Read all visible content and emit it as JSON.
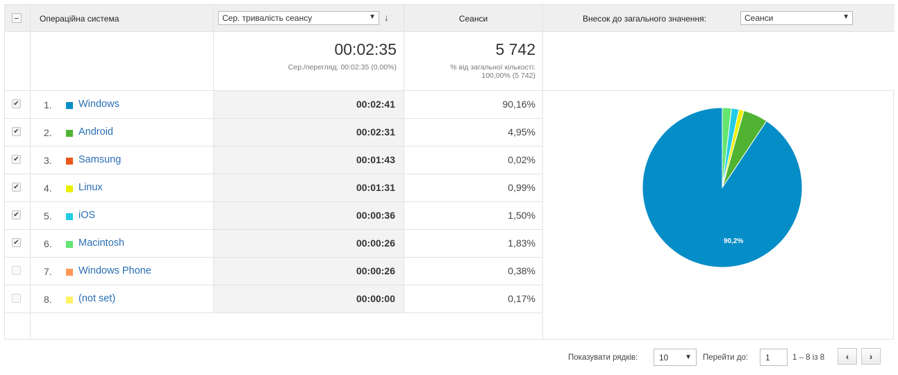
{
  "header": {
    "dimension_label": "Операційна система",
    "metric_select": "Сер. тривалість сеансу",
    "sessions_label": "Сеанси",
    "contribution_label": "Внесок до загального значення:",
    "contribution_select": "Сеанси"
  },
  "summary": {
    "duration_value": "00:02:35",
    "duration_sub": "Сер./перегляд: 00:02:35 (0,00%)",
    "sessions_value": "5 742",
    "sessions_sub_1": "% від загальної кількості:",
    "sessions_sub_2": "100,00% (5 742)"
  },
  "rows": [
    {
      "rank": "1.",
      "os": "Windows",
      "color": "#058dc7",
      "duration": "00:02:41",
      "pct": "90,16%",
      "checked": true
    },
    {
      "rank": "2.",
      "os": "Android",
      "color": "#50b432",
      "duration": "00:02:31",
      "pct": "4,95%",
      "checked": true
    },
    {
      "rank": "3.",
      "os": "Samsung",
      "color": "#ed561b",
      "duration": "00:01:43",
      "pct": "0,02%",
      "checked": true
    },
    {
      "rank": "4.",
      "os": "Linux",
      "color": "#edef00",
      "duration": "00:01:31",
      "pct": "0,99%",
      "checked": true
    },
    {
      "rank": "5.",
      "os": "iOS",
      "color": "#24cbe5",
      "duration": "00:00:36",
      "pct": "1,50%",
      "checked": true
    },
    {
      "rank": "6.",
      "os": "Macintosh",
      "color": "#64e572",
      "duration": "00:00:26",
      "pct": "1,83%",
      "checked": true
    },
    {
      "rank": "7.",
      "os": "Windows Phone",
      "color": "#ff9655",
      "duration": "00:00:26",
      "pct": "0,38%",
      "checked": false
    },
    {
      "rank": "8.",
      "os": "(not set)",
      "color": "#fff263",
      "duration": "00:00:00",
      "pct": "0,17%",
      "checked": false
    }
  ],
  "chart_data": {
    "type": "pie",
    "labels": [
      "Windows",
      "Android",
      "Samsung",
      "Linux",
      "iOS",
      "Macintosh"
    ],
    "values": [
      90.16,
      4.95,
      0.02,
      0.99,
      1.5,
      1.83
    ],
    "colors": [
      "#058dc7",
      "#50b432",
      "#ed561b",
      "#edef00",
      "#24cbe5",
      "#64e572"
    ],
    "data_labels": [
      "90,2%"
    ]
  },
  "footer": {
    "rows_label": "Показувати рядків:",
    "rows_value": "10",
    "goto_label": "Перейти до:",
    "goto_value": "1",
    "range_text": "1 – 8 із 8",
    "prev_glyph": "‹",
    "next_glyph": "›"
  },
  "icons": {
    "checkmark": "✔",
    "dropdown": "▼",
    "sort_down": "↓"
  }
}
